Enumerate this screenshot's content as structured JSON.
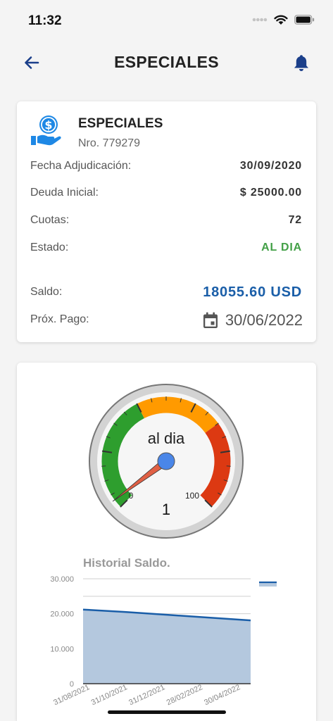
{
  "status": {
    "time": "11:32"
  },
  "header": {
    "title": "ESPECIALES"
  },
  "product": {
    "title": "ESPECIALES",
    "number": "Nro. 779279"
  },
  "details": {
    "fecha_label": "Fecha Adjudicación:",
    "fecha_value": "30/09/2020",
    "deuda_label": "Deuda Inicial:",
    "deuda_value": "$ 25000.00",
    "cuotas_label": "Cuotas:",
    "cuotas_value": "72",
    "estado_label": "Estado:",
    "estado_value": "AL DIA",
    "saldo_label": "Saldo:",
    "saldo_value": "18055.60 USD",
    "prox_label": "Próx. Pago:",
    "prox_value": "30/06/2022"
  },
  "gauge": {
    "label": "al dia",
    "value_text": "1",
    "value": 1,
    "min_label": "0",
    "max_label": "100",
    "min": 0,
    "max": 100,
    "colors": {
      "green": "#2e9e2e",
      "orange": "#ff9a00",
      "red": "#dc3912",
      "needle": "#e06045",
      "hub": "#4a86e8"
    }
  },
  "chart_data": {
    "type": "area",
    "title": "Historial Saldo.",
    "x": [
      "31/08/2021",
      "31/10/2021",
      "31/12/2021",
      "28/02/2022",
      "30/04/2022"
    ],
    "series": [
      {
        "values": [
          21200,
          20500,
          19700,
          18900,
          18100
        ]
      }
    ],
    "yticks": [
      "0",
      "10.000",
      "20.000",
      "30.000"
    ],
    "ylim": [
      0,
      30000
    ],
    "color": "#1a5ea8",
    "fill": "#b4c8de",
    "grid": true,
    "legend": "right"
  }
}
